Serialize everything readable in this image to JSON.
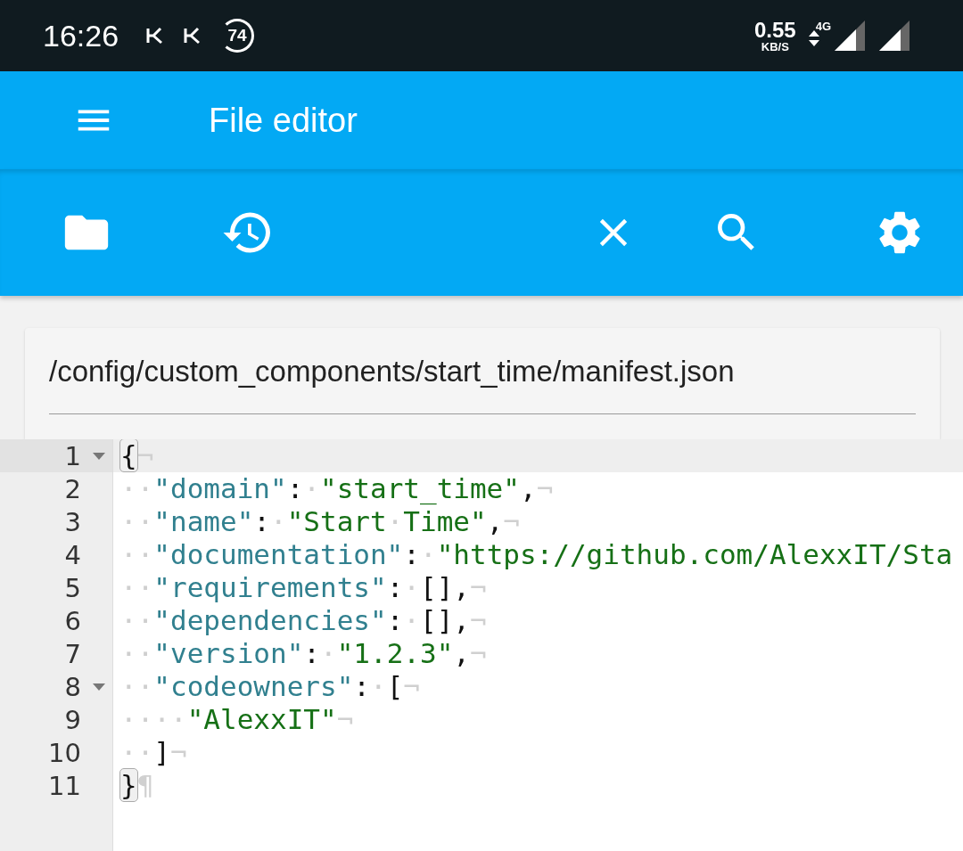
{
  "status_bar": {
    "time": "16:26",
    "badge": "74",
    "net_speed": "0.55",
    "net_speed_unit": "KB/S",
    "network_type": "4G"
  },
  "app_bar": {
    "title": "File editor"
  },
  "file_path": {
    "value": "/config/custom_components/start_time/manifest.json"
  },
  "editor": {
    "lines": [
      {
        "number": "1",
        "active": true,
        "foldable": true,
        "tokens": [
          {
            "kind": "bracket",
            "text": "{"
          },
          {
            "kind": "eol",
            "text": "¬"
          }
        ]
      },
      {
        "number": "2",
        "active": false,
        "foldable": false,
        "tokens": [
          {
            "kind": "ws",
            "text": "··"
          },
          {
            "kind": "key",
            "text": "\"domain\""
          },
          {
            "kind": "punct",
            "text": ":"
          },
          {
            "kind": "ws",
            "text": "·"
          },
          {
            "kind": "string",
            "text": "\"start_time\""
          },
          {
            "kind": "punct",
            "text": ","
          },
          {
            "kind": "eol",
            "text": "¬"
          }
        ]
      },
      {
        "number": "3",
        "active": false,
        "foldable": false,
        "tokens": [
          {
            "kind": "ws",
            "text": "··"
          },
          {
            "kind": "key",
            "text": "\"name\""
          },
          {
            "kind": "punct",
            "text": ":"
          },
          {
            "kind": "ws",
            "text": "·"
          },
          {
            "kind": "string",
            "text": "\"Start"
          },
          {
            "kind": "ws",
            "text": "·"
          },
          {
            "kind": "string",
            "text": "Time\""
          },
          {
            "kind": "punct",
            "text": ","
          },
          {
            "kind": "eol",
            "text": "¬"
          }
        ]
      },
      {
        "number": "4",
        "active": false,
        "foldable": false,
        "tokens": [
          {
            "kind": "ws",
            "text": "··"
          },
          {
            "kind": "key",
            "text": "\"documentation\""
          },
          {
            "kind": "punct",
            "text": ":"
          },
          {
            "kind": "ws",
            "text": "·"
          },
          {
            "kind": "string",
            "text": "\"https://github.com/AlexxIT/Sta"
          }
        ]
      },
      {
        "number": "5",
        "active": false,
        "foldable": false,
        "tokens": [
          {
            "kind": "ws",
            "text": "··"
          },
          {
            "kind": "key",
            "text": "\"requirements\""
          },
          {
            "kind": "punct",
            "text": ":"
          },
          {
            "kind": "ws",
            "text": "·"
          },
          {
            "kind": "punct",
            "text": "[],"
          },
          {
            "kind": "eol",
            "text": "¬"
          }
        ]
      },
      {
        "number": "6",
        "active": false,
        "foldable": false,
        "tokens": [
          {
            "kind": "ws",
            "text": "··"
          },
          {
            "kind": "key",
            "text": "\"dependencies\""
          },
          {
            "kind": "punct",
            "text": ":"
          },
          {
            "kind": "ws",
            "text": "·"
          },
          {
            "kind": "punct",
            "text": "[],"
          },
          {
            "kind": "eol",
            "text": "¬"
          }
        ]
      },
      {
        "number": "7",
        "active": false,
        "foldable": false,
        "tokens": [
          {
            "kind": "ws",
            "text": "··"
          },
          {
            "kind": "key",
            "text": "\"version\""
          },
          {
            "kind": "punct",
            "text": ":"
          },
          {
            "kind": "ws",
            "text": "·"
          },
          {
            "kind": "string",
            "text": "\"1.2.3\""
          },
          {
            "kind": "punct",
            "text": ","
          },
          {
            "kind": "eol",
            "text": "¬"
          }
        ]
      },
      {
        "number": "8",
        "active": false,
        "foldable": true,
        "tokens": [
          {
            "kind": "ws",
            "text": "··"
          },
          {
            "kind": "key",
            "text": "\"codeowners\""
          },
          {
            "kind": "punct",
            "text": ":"
          },
          {
            "kind": "ws",
            "text": "·"
          },
          {
            "kind": "punct",
            "text": "["
          },
          {
            "kind": "eol",
            "text": "¬"
          }
        ]
      },
      {
        "number": "9",
        "active": false,
        "foldable": false,
        "tokens": [
          {
            "kind": "ws",
            "text": "····"
          },
          {
            "kind": "string",
            "text": "\"AlexxIT\""
          },
          {
            "kind": "eol",
            "text": "¬"
          }
        ]
      },
      {
        "number": "10",
        "active": false,
        "foldable": false,
        "tokens": [
          {
            "kind": "ws",
            "text": "··"
          },
          {
            "kind": "punct",
            "text": "]"
          },
          {
            "kind": "eol",
            "text": "¬"
          }
        ]
      },
      {
        "number": "11",
        "active": false,
        "foldable": false,
        "tokens": [
          {
            "kind": "bracket",
            "text": "}"
          },
          {
            "kind": "eol",
            "text": "¶"
          }
        ]
      }
    ]
  }
}
